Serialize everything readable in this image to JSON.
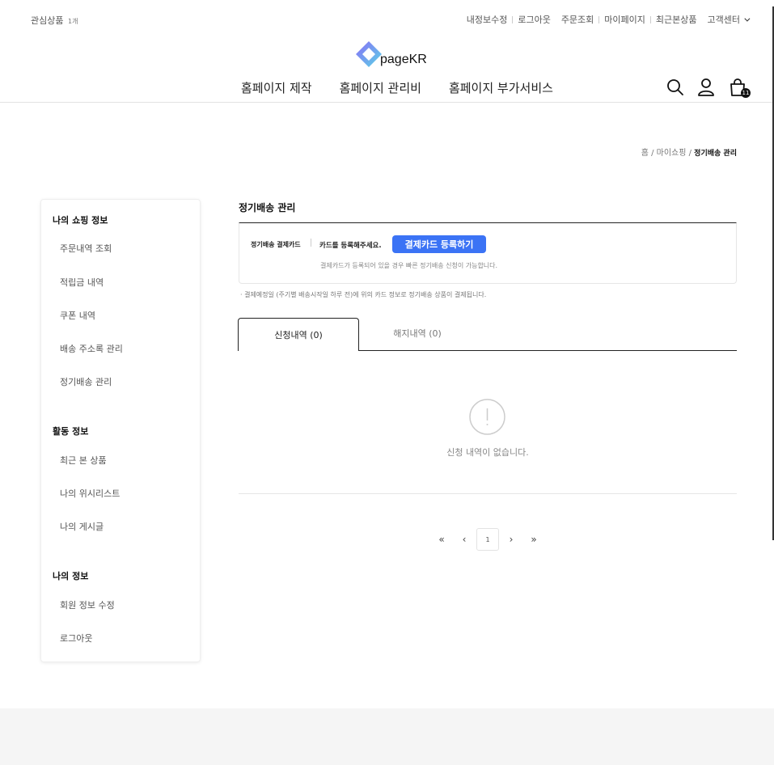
{
  "topbar": {
    "wishlist_label": "관심상품",
    "wishlist_count": "1개",
    "links": [
      "내정보수정",
      "로그아웃",
      "주문조회",
      "마이페이지",
      "최근본상품",
      "고객센터"
    ]
  },
  "logo": {
    "text": "pageKR"
  },
  "nav": {
    "items": [
      "홈페이지 제작",
      "홈페이지 관리비",
      "홈페이지 부가서비스"
    ]
  },
  "header_icons": [
    "search-icon",
    "user-icon",
    "cart-icon"
  ],
  "cart_badge": "11",
  "breadcrumb": {
    "home": "홈",
    "section": "마이쇼핑",
    "current": "정기배송 관리"
  },
  "sidebar": {
    "groups": [
      {
        "title": "나의 쇼핑 정보",
        "items": [
          "주문내역 조회",
          "적립금 내역",
          "쿠폰 내역",
          "배송 주소록 관리",
          "정기배송 관리"
        ]
      },
      {
        "title": "활동 정보",
        "items": [
          "최근 본 상품",
          "나의 위시리스트",
          "나의 게시글"
        ]
      },
      {
        "title": "나의 정보",
        "items": [
          "회원 정보 수정",
          "로그아웃"
        ]
      }
    ]
  },
  "content": {
    "title": "정기배송 관리",
    "card_label": "정기배송 결제카드",
    "card_message": "카드를 등록해주세요.",
    "card_button": "결제카드 등록하기",
    "card_sub": "결제카드가 등록되어 있을 경우 빠른 정기배송 신청이 가능합니다.",
    "note": "· 결제예정일 (주기별 배송시작일 하루 전)에 위의 카드 정보로 정기배송 상품이 결제됩니다.",
    "tabs": [
      "신청내역 (0)",
      "해지내역 (0)"
    ],
    "empty_text": "신청 내역이 없습니다."
  },
  "pagination": {
    "first": "«",
    "prev": "‹",
    "current": "1",
    "next": "›",
    "last": "»"
  },
  "colors": {
    "accent": "#3b73f5",
    "logo_gradient_start": "#7b6cf6",
    "logo_gradient_end": "#5fd3e8"
  }
}
